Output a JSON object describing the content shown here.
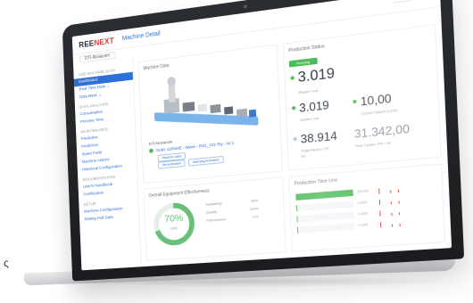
{
  "header": {
    "logo_main": "REE",
    "logo_accent": "NEXT",
    "title": "Machine Detail",
    "user_line1": "————",
    "user_line2": "———"
  },
  "subbar": {
    "selected": "DTI-Novacom"
  },
  "sidebar": {
    "sections": [
      {
        "label": "USE MACHINE DATA",
        "items": [
          {
            "label": "Dashboard",
            "active": true
          },
          {
            "label": "Real Time Data ⌄"
          },
          {
            "label": "Data Base ⌄"
          }
        ]
      },
      {
        "label": "DATA ANALYSIS",
        "items": [
          {
            "label": "Consumption"
          },
          {
            "label": "Process Time"
          }
        ]
      },
      {
        "label": "MAINTENANCE",
        "items": [
          {
            "label": "Predictive"
          },
          {
            "label": "Predictive"
          },
          {
            "label": "Spare Parts"
          },
          {
            "label": "Machine Alarms"
          },
          {
            "label": "Historical Configuration"
          }
        ]
      },
      {
        "label": "DOCUMENTATION",
        "items": [
          {
            "label": "User's Handbook"
          },
          {
            "label": "Certification"
          }
        ]
      },
      {
        "label": "SETUP",
        "items": [
          {
            "label": "Machine Configuration"
          },
          {
            "label": "Setting Pull Data"
          }
        ]
      }
    ]
  },
  "machine": {
    "card_title": "Machine Data",
    "name": "DTI-Novacom",
    "status_text": "Order 22/NsrtE - Week - Rol1_102-Tsy - tol 1",
    "pills_row1": [
      "Machine data"
    ],
    "pills_row2": [
      "Set Activated",
      "Warning Activated"
    ]
  },
  "production": {
    "card_title": "Production Status",
    "badge": "Running",
    "pieces_value": "3.019",
    "pieces_label": "Pieces / cut",
    "cycles_value": "3.019",
    "cycles_label": "Cycles / cut",
    "speed_value": "10,00",
    "speed_label": "Current Speed (Cp/h)",
    "total_pieces_value": "38.914",
    "total_pieces_label": "Total Pieces / PS",
    "total_pieces_sub": "Ps",
    "total_cycles_value": "31.342,00",
    "total_cycles_label": "Total Cycles / PS / hs"
  },
  "oee": {
    "card_title": "Overall Equipment Effectiveness",
    "value_text": "70%",
    "value_fraction": 0.7,
    "unit": "OEE",
    "rows": [
      {
        "label": "Availability",
        "value": "99%"
      },
      {
        "label": "Quality",
        "value": "100%"
      },
      {
        "label": "Performance",
        "value": "71%"
      }
    ]
  },
  "timeline": {
    "card_title": "Production Time Line",
    "rows": [
      {
        "label": "",
        "fraction": 1.0,
        "pct": "100.0%"
      },
      {
        "label": "",
        "fraction": 0.02,
        "pct": "1.00%"
      },
      {
        "label": "",
        "fraction": 0.02,
        "pct": "0.00%"
      },
      {
        "label": "",
        "fraction": 0.02,
        "pct": "0.00%"
      }
    ]
  },
  "colors": {
    "accent": "#2f6fd8",
    "ok": "#4dbb5a",
    "warn": "#e05252",
    "oee": "#6ac07a"
  },
  "footer_text": "ς"
}
